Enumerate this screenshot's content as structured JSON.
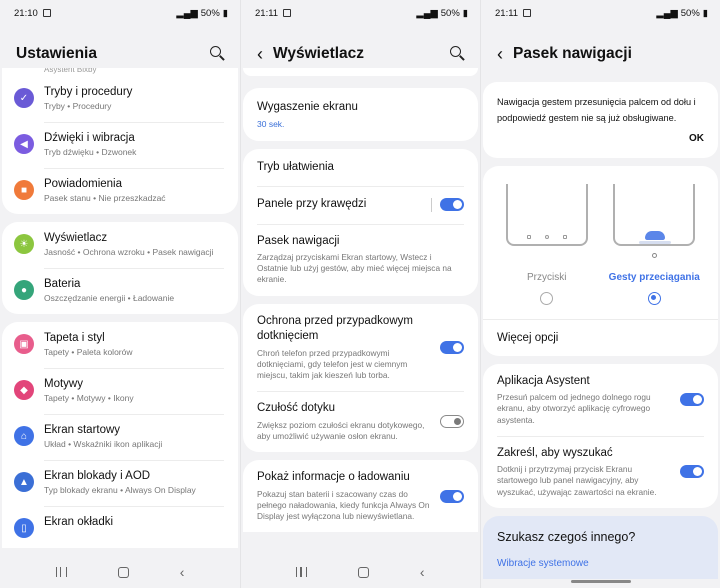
{
  "colors": {
    "accent": "#3f72e6",
    "link": "#3a6fd8"
  },
  "screen1": {
    "status": {
      "time": "21:10",
      "battery": "50%"
    },
    "title": "Ustawienia",
    "clipped_top": "Asystent Bixby",
    "groups": [
      [
        {
          "icon": "modes-icon",
          "color": "#6a5ad6",
          "title": "Tryby i procedury",
          "subtitle": "Tryby  •  Procedury"
        },
        {
          "icon": "sound-icon",
          "color": "#7b5ce0",
          "title": "Dźwięki i wibracja",
          "subtitle": "Tryb dźwięku  •  Dzwonek"
        },
        {
          "icon": "notifications-icon",
          "color": "#f07a3a",
          "title": "Powiadomienia",
          "subtitle": "Pasek stanu  •  Nie przeszkadzać"
        }
      ],
      [
        {
          "icon": "display-icon",
          "color": "#8cc63f",
          "title": "Wyświetlacz",
          "subtitle": "Jasność  •  Ochrona wzroku  •  Pasek nawigacji"
        },
        {
          "icon": "battery-icon",
          "color": "#35a57a",
          "title": "Bateria",
          "subtitle": "Oszczędzanie energii  •  Ładowanie"
        }
      ],
      [
        {
          "icon": "wallpaper-icon",
          "color": "#e85d8c",
          "title": "Tapeta i styl",
          "subtitle": "Tapety  •  Paleta kolorów"
        },
        {
          "icon": "themes-icon",
          "color": "#e2457a",
          "title": "Motywy",
          "subtitle": "Tapety  •  Motywy  •  Ikony"
        },
        {
          "icon": "home-screen-icon",
          "color": "#3f72e6",
          "title": "Ekran startowy",
          "subtitle": "Układ  •  Wskaźniki ikon aplikacji"
        },
        {
          "icon": "lock-screen-icon",
          "color": "#3b6fd6",
          "title": "Ekran blokady i AOD",
          "subtitle": "Typ blokady ekranu  •  Always On Display"
        },
        {
          "icon": "cover-screen-icon",
          "color": "#3f72e6",
          "title": "Ekran okładki",
          "subtitle": ""
        }
      ]
    ]
  },
  "screen2": {
    "status": {
      "time": "21:11",
      "battery": "50%"
    },
    "title": "Wyświetlacz",
    "screen_timeout": {
      "title": "Wygaszenie ekranu",
      "value": "30 sek."
    },
    "group2": {
      "easy_mode": "Tryb ułatwienia",
      "edge_panels": "Panele przy krawędzi",
      "nav_bar_title": "Pasek nawigacji",
      "nav_bar_desc": "Zarządzaj przyciskami Ekran startowy, Wstecz i Ostatnie lub użyj gestów, aby mieć więcej miejsca na ekranie."
    },
    "group3": {
      "accidental_title": "Ochrona przed przypadkowym dotknięciem",
      "accidental_desc": "Chroń telefon przed przypadkowymi dotknięciami, gdy telefon jest w ciemnym miejscu, takim jak kieszeń lub torba.",
      "touch_title": "Czułość dotyku",
      "touch_desc": "Zwiększ poziom czułości ekranu dotykowego, aby umożliwić używanie osłon ekranu."
    },
    "group4": {
      "charging_title": "Pokaż informacje o ładowaniu",
      "charging_desc": "Pokazuj stan baterii i szacowany czas do pełnego naładowania, kiedy funkcja Always On Display jest wyłączona lub niewyświetlana."
    }
  },
  "screen3": {
    "status": {
      "time": "21:11",
      "battery": "50%"
    },
    "title": "Pasek nawigacji",
    "notice": "Nawigacja gestem przesunięcia palcem od dołu i podpowiedź gestem nie są już obsługiwane.",
    "ok_label": "OK",
    "options": {
      "buttons": "Przyciski",
      "gestures": "Gesty przeciągania",
      "selected": "gestures"
    },
    "more_options": "Więcej opcji",
    "assistant_title": "Aplikacja Asystent",
    "assistant_desc": "Przesuń palcem od jednego dolnego rogu ekranu, aby otworzyć aplikację cyfrowego asystenta.",
    "circle_title": "Zakreśl, aby wyszukać",
    "circle_desc": "Dotknij i przytrzymaj przycisk Ekranu startowego lub panel nawigacyjny, aby wyszukać, używając zawartości na ekranie.",
    "search_question": "Szukasz czegoś innego?",
    "search_link": "Wibracje systemowe"
  }
}
